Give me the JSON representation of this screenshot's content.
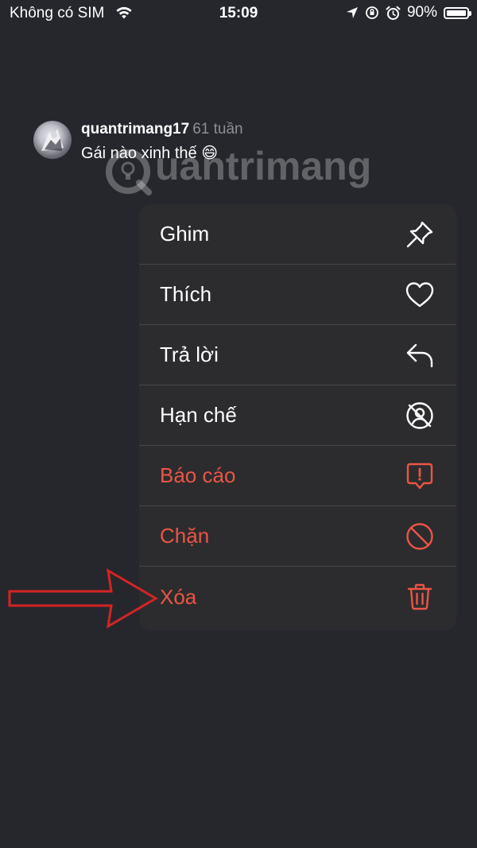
{
  "status_bar": {
    "carrier": "Không có SIM",
    "time": "15:09",
    "battery_percent": "90%"
  },
  "comment": {
    "username": "quantrimang17",
    "time_ago": "61 tuần",
    "text": "Gái nào xinh thế 😄"
  },
  "watermark": {
    "text": "uantrimang"
  },
  "menu": {
    "items": [
      {
        "label": "Ghim",
        "icon": "pin-icon",
        "style": "normal"
      },
      {
        "label": "Thích",
        "icon": "heart-icon",
        "style": "normal"
      },
      {
        "label": "Trả lời",
        "icon": "reply-icon",
        "style": "normal"
      },
      {
        "label": "Hạn chế",
        "icon": "restrict-icon",
        "style": "normal"
      },
      {
        "label": "Báo cáo",
        "icon": "report-icon",
        "style": "danger"
      },
      {
        "label": "Chặn",
        "icon": "block-icon",
        "style": "danger"
      },
      {
        "label": "Xóa",
        "icon": "trash-icon",
        "style": "danger"
      }
    ]
  },
  "colors": {
    "background": "#26272d",
    "menu_background": "#2c2c2e",
    "danger": "#eb5545",
    "annotation_arrow": "#d42424"
  }
}
